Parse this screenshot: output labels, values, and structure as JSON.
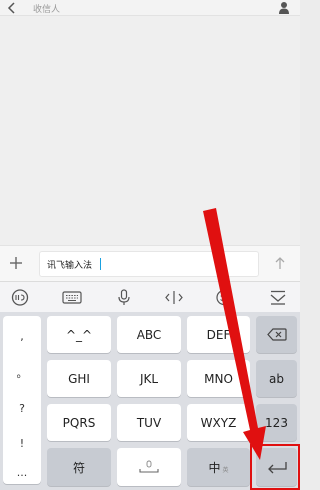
{
  "header": {
    "title": "收信人"
  },
  "composer": {
    "input_value": "讯飞输入法"
  },
  "keyboard": {
    "symbols": [
      ",",
      "。",
      "?",
      "!",
      "..."
    ],
    "row1": [
      "^_^",
      "ABC",
      "DEF"
    ],
    "row2": [
      "GHI",
      "JKL",
      "MNO"
    ],
    "row3": [
      "PQRS",
      "TUV",
      "WXYZ"
    ],
    "ab_label": "ab",
    "num_label": "123",
    "sym_label": "符",
    "zh_label": "中",
    "zh_sub": "英"
  },
  "colors": {
    "annotation": "#e01010",
    "caret": "#1aa1e0"
  },
  "icons": [
    "back-icon",
    "person-icon",
    "plus-icon",
    "send-icon",
    "ime-logo-icon",
    "keyboard-icon",
    "microphone-icon",
    "cursor-move-icon",
    "emoji-icon",
    "collapse-keyboard-icon",
    "backspace-icon",
    "space-icon",
    "enter-icon"
  ]
}
